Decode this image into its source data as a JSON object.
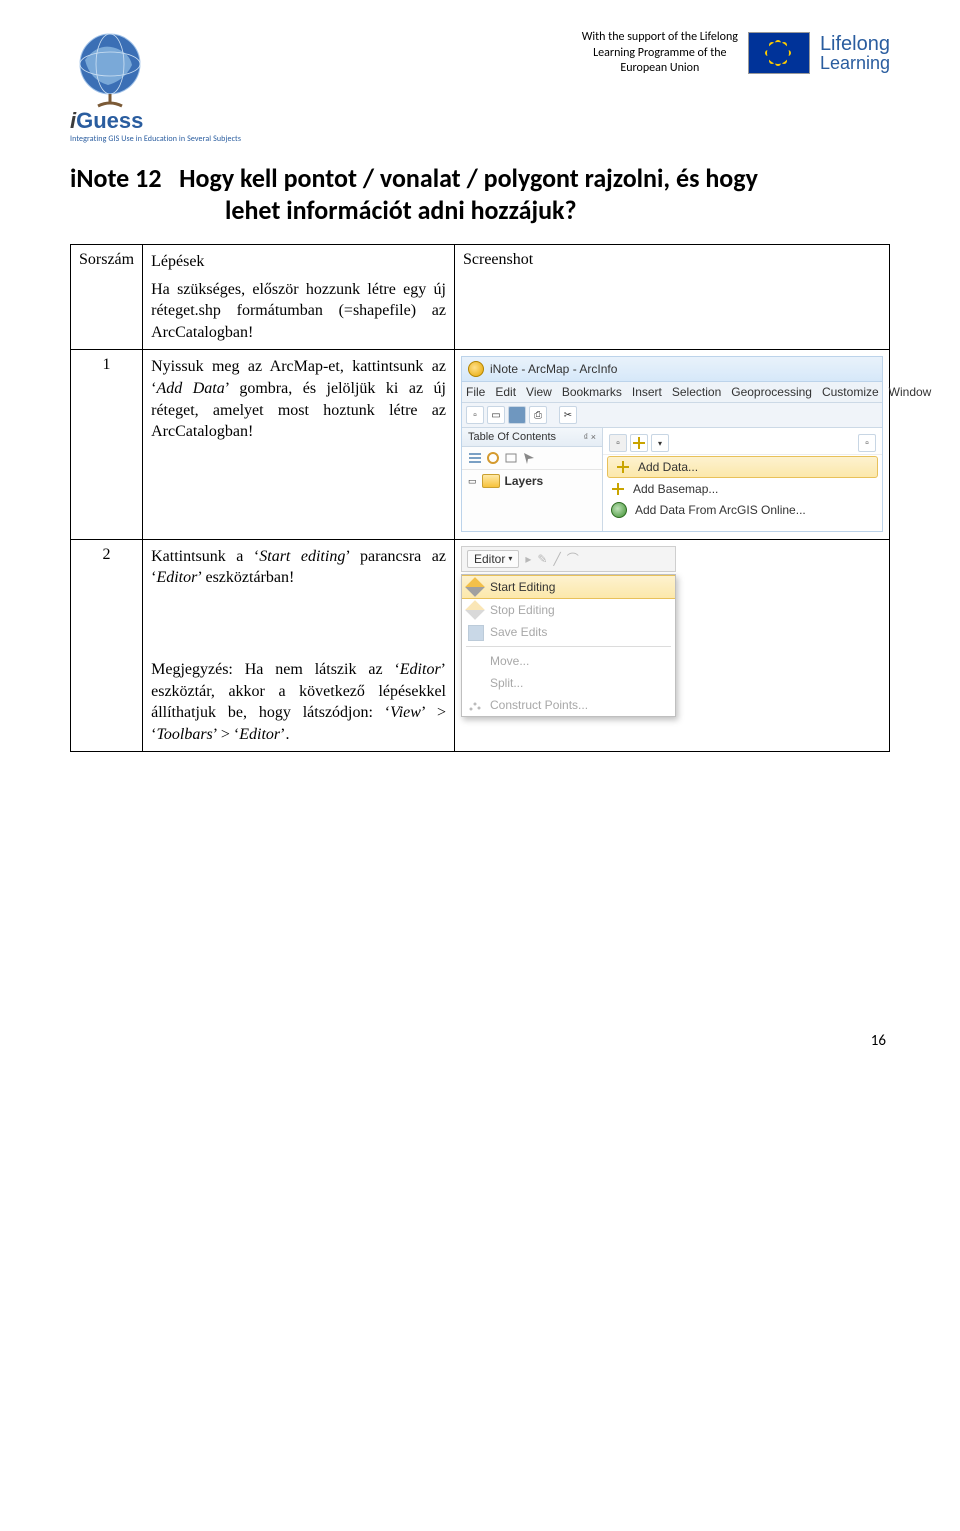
{
  "header": {
    "iguess_brand_prefix": "i",
    "iguess_brand": "Guess",
    "iguess_tagline": "Integrating GIS Use in Education in Several Subjects",
    "support_line1": "With the support of the Lifelong",
    "support_line2": "Learning Programme of the",
    "support_line3": "European Union",
    "lll_top": "Lifelong",
    "lll_bottom": "Learning"
  },
  "title_prefix": "iNote 12",
  "title_rest": "Hogy kell pontot / vonalat / polygont rajzolni, és hogy",
  "title_line2": "lehet információt adni hozzájuk?",
  "table": {
    "col1": "Sorszám",
    "col2": "Lépések",
    "col3": "Screenshot",
    "intro": "Ha szükséges, először hozzunk létre egy új réteget.shp formátumban (=shapefile) az ArcCatalogban!",
    "row1_num": "1",
    "row1_text_a": "Nyissuk meg az ArcMap-et, kattintsunk az ‘",
    "row1_text_b": "Add Data",
    "row1_text_c": "’ gombra, és jelöljük ki az új réteget, amelyet most hoztunk létre az ArcCatalogban!",
    "row2_num": "2",
    "row2_text_a": "Kattintsunk a ‘",
    "row2_text_b": "Start editing",
    "row2_text_c": "’ parancsra az ‘",
    "row2_text_d": "Editor",
    "row2_text_e": "’ eszköztárban!",
    "row2_note_a": "Megjegyzés: Ha nem látszik az ‘",
    "row2_note_b": "Editor",
    "row2_note_c": "’ eszköztár, akkor a következő lépésekkel állíthatjuk be, hogy látszódjon: ‘",
    "row2_note_d": "View",
    "row2_note_e": "’ > ‘",
    "row2_note_f": "Toolbars",
    "row2_note_g": "’ > ‘",
    "row2_note_h": "Editor",
    "row2_note_i": "’."
  },
  "arcmap": {
    "title": "iNote - ArcMap - ArcInfo",
    "menus": [
      "File",
      "Edit",
      "View",
      "Bookmarks",
      "Insert",
      "Selection",
      "Geoprocessing",
      "Customize",
      "Window"
    ],
    "toc_title": "Table Of Contents",
    "toc_pin": "₫ ×",
    "layers": "Layers",
    "dd_add_data": "Add Data...",
    "dd_add_basemap": "Add Basemap...",
    "dd_add_online": "Add Data From ArcGIS Online..."
  },
  "editor": {
    "button": "Editor",
    "start": "Start Editing",
    "stop": "Stop Editing",
    "save": "Save Edits",
    "move": "Move...",
    "split": "Split...",
    "construct": "Construct Points..."
  },
  "page_number": "16"
}
